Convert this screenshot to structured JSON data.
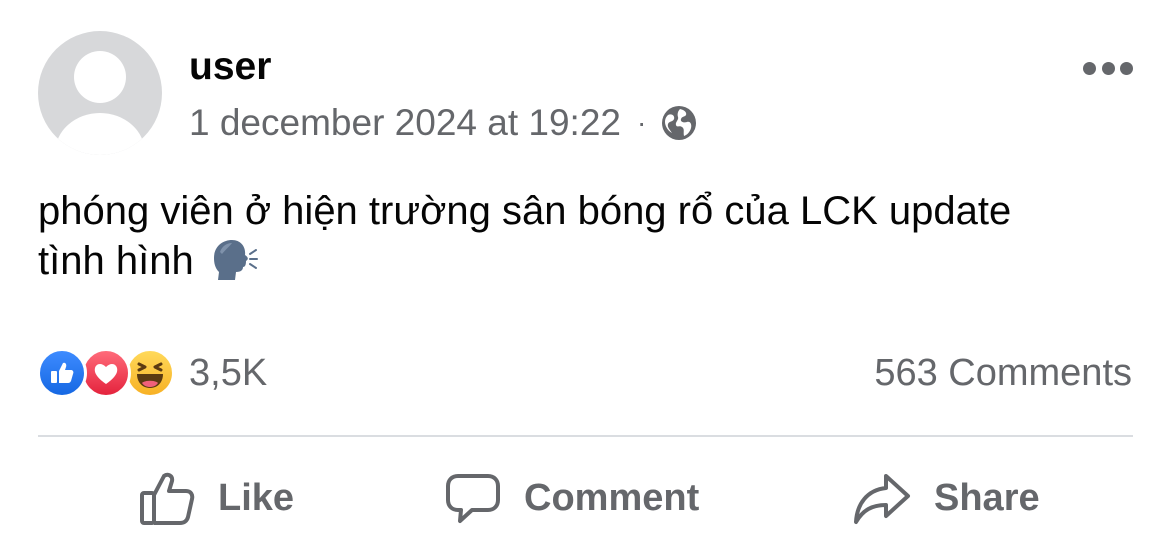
{
  "post": {
    "author": "user",
    "timestamp": "1 december 2024 at 19:22",
    "separator": "·",
    "audience_icon": "globe-icon",
    "menu_icon": "more-options-icon",
    "text_line1": "phóng viên ở hiện trường sân bóng rổ của LCK update",
    "text_line2": "tình hình",
    "text_emoji": "speaking-head-icon"
  },
  "stats": {
    "reaction_icons": [
      "like-reaction-icon",
      "love-reaction-icon",
      "haha-reaction-icon"
    ],
    "reaction_count": "3,5K",
    "comments": "563 Comments"
  },
  "actions": {
    "like": "Like",
    "comment": "Comment",
    "share": "Share"
  },
  "colors": {
    "secondary_text": "#65676b",
    "like_blue": "#1877f2",
    "love_red": "#f33e58",
    "haha_yellow": "#f7b928",
    "divider": "#dadde1"
  }
}
